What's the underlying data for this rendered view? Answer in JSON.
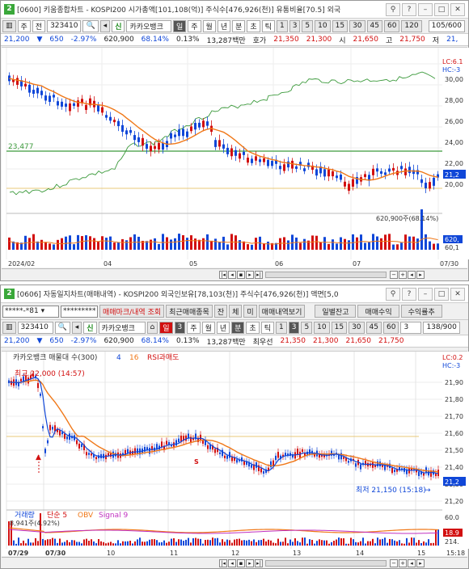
{
  "win1": {
    "num": "2",
    "title": "[0600] 키움종합차트 - KOSPI200 시가총액[101,108(억)] 주식수[476,926(천)] 유통비율[70.5] 외국",
    "toolbar": {
      "market": "주",
      "menu": "전",
      "code": "323410",
      "sin": "신",
      "name": "카카오뱅크",
      "periods": [
        "일",
        "주",
        "월",
        "년",
        "분",
        "초",
        "틱"
      ],
      "nums": [
        "1",
        "3",
        "5",
        "10",
        "15",
        "30",
        "45",
        "60",
        "120"
      ],
      "count": "105/600"
    },
    "info": {
      "price": "21,200",
      "change": "650",
      "pct": "-2.97%",
      "volume": "620,900",
      "ratio": "68.14%",
      "turnover": "0.13%",
      "amount": "13,287백만",
      "hoga_label": "호가",
      "ask": "21,350",
      "bid": "21,300",
      "open_label": "시",
      "open": "21,650",
      "high_label": "고",
      "high": "21,750",
      "low_label": "저",
      "low": "21,"
    },
    "chart": {
      "ma_label": "23,477",
      "y_ticks": [
        "30,00",
        "28,00",
        "26,00",
        "24,00",
        "22,00",
        "20,00"
      ],
      "lc": "LC:6.1",
      "hc": "HC:-3",
      "right_price": "21,2",
      "vol_label": "620,900주(68.14%)",
      "vol_right": [
        "620,",
        "60,1"
      ],
      "x_labels": [
        "2024/02",
        "04",
        "05",
        "06",
        "07",
        "07/30"
      ]
    }
  },
  "win2": {
    "num": "2",
    "title": "[0606] 자동일지차트(매매내역) - KOSPI200 외국인보유[78,103(천)] 주식수[476,926(천)] 액면[5,0",
    "row1": {
      "account": "*****-*81",
      "password": "*********",
      "btn1": "매매마크/내역 조회",
      "btn2": "최근매매종목",
      "btn3": "잔",
      "btn4": "체",
      "btn5": "미",
      "btn6": "매매내역보기",
      "btn7": "일별잔고",
      "btn8": "매매수익",
      "btn9": "수익률추"
    },
    "row2": {
      "code": "323410",
      "sin": "신",
      "name": "카카오뱅크",
      "period": "일",
      "p_num": "3",
      "periods": [
        "주",
        "월",
        "년",
        "분",
        "초",
        "틱"
      ],
      "sel1": "1",
      "sel2": "3",
      "nums": [
        "5",
        "10",
        "15",
        "30",
        "45",
        "60"
      ],
      "box_num": "3",
      "count": "138/900"
    },
    "info": {
      "price": "21,200",
      "change": "650",
      "pct": "-2.97%",
      "volume": "620,900",
      "ratio": "68.14%",
      "turnover": "0.13%",
      "amount": "13,287백만",
      "label": "최우선",
      "ask": "21,350",
      "bid": "21,300",
      "open": "21,650",
      "high": "21,750"
    },
    "chart": {
      "legend": "카카오뱅크 매물대 수(300)",
      "legend2": "4",
      "legend3": "16",
      "legend4": "RSI과매도",
      "max_label": "최고 22,000 (14:57)",
      "min_label": "최저 21,150 (15:18)",
      "sell_mark": "S",
      "y_ticks": [
        "21,90",
        "21,80",
        "21,70",
        "21,60",
        "21,50",
        "21,40",
        "21,30",
        "21,20"
      ],
      "lc": "LC:0.2",
      "hc": "HC:-3",
      "right_price": "21,2",
      "bottom_legend": "거래량",
      "bottom_legend2": "단순 5",
      "bottom_legend3": "OBV",
      "bottom_legend4": "Signal 9",
      "vol_label": "8,941주(4.92%)",
      "vol_right": [
        "60.0",
        "18.9",
        "214."
      ],
      "x_labels": [
        "07/29",
        "07/30",
        "10",
        "11",
        "12",
        "13",
        "14",
        "15",
        "15:18"
      ]
    }
  },
  "colors": {
    "up": "#d21010",
    "down": "#1047d8",
    "ma": "#f07818",
    "foreign": "#3c9a3c",
    "accent": "#3aa83a"
  }
}
